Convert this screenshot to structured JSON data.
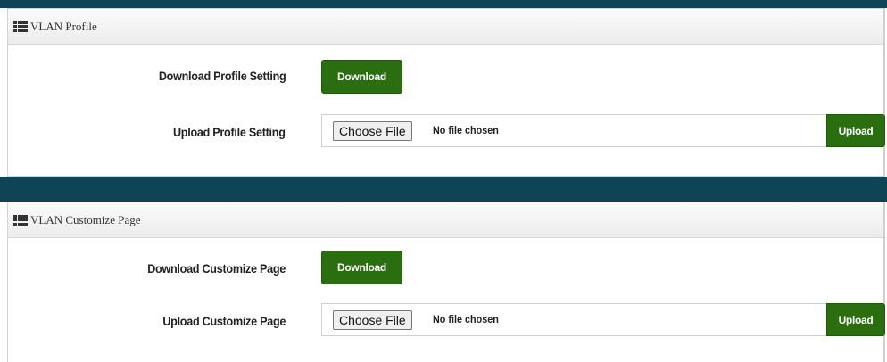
{
  "sections": [
    {
      "title": "VLAN Profile",
      "download_row": {
        "label": "Download Profile Setting",
        "button_label": "Download"
      },
      "upload_row": {
        "label": "Upload Profile Setting",
        "choose_file_label": "Choose File",
        "file_status": "No file chosen",
        "upload_label": "Upload"
      }
    },
    {
      "title": "VLAN Customize Page",
      "download_row": {
        "label": "Download Customize Page",
        "button_label": "Download"
      },
      "upload_row": {
        "label": "Upload Customize Page",
        "choose_file_label": "Choose File",
        "file_status": "No file chosen",
        "upload_label": "Upload"
      }
    }
  ],
  "icons": {
    "panel_header_icon": "list-icon"
  },
  "colors": {
    "accent_green": "#2a6e10",
    "header_band": "#0f4457"
  }
}
